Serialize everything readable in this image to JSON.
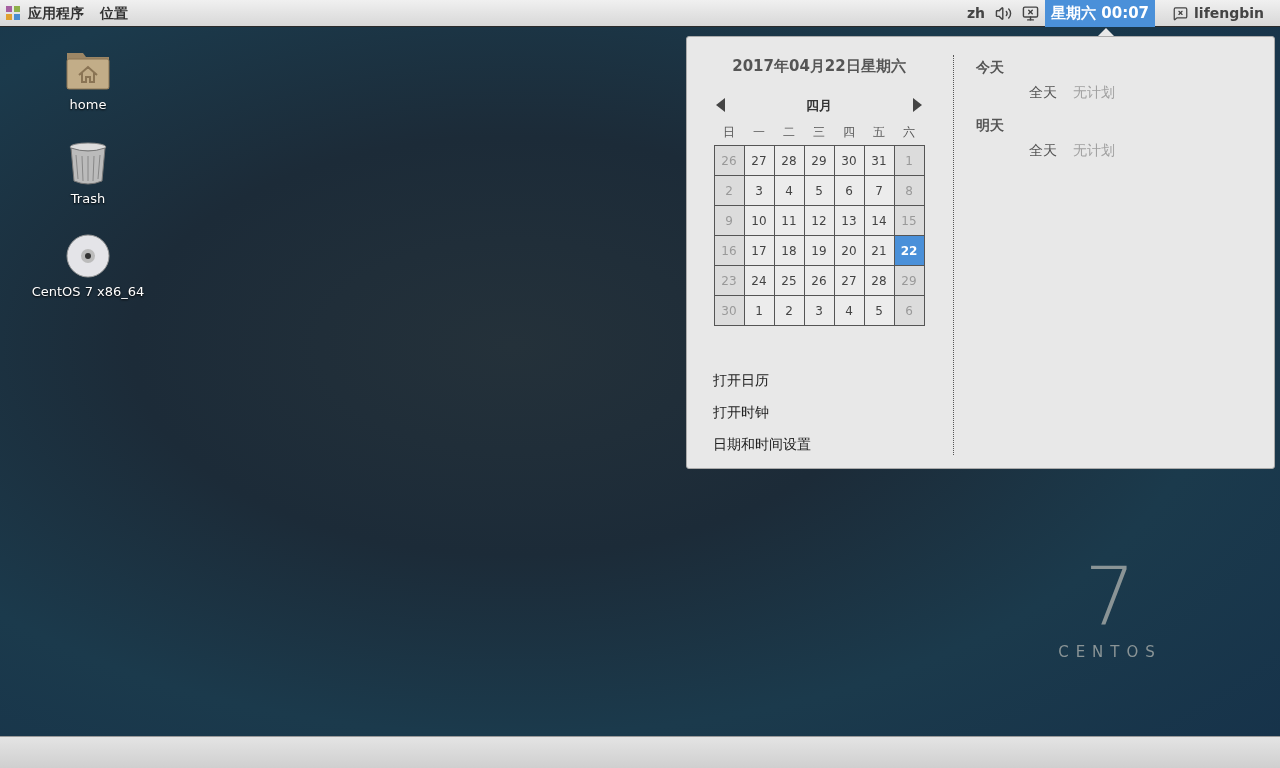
{
  "top_bar": {
    "menus": [
      {
        "label": "应用程序"
      },
      {
        "label": "位置"
      }
    ],
    "language": "zh",
    "clock": {
      "label": "星期六 00:07",
      "selected": true
    },
    "user": "lifengbin"
  },
  "desktop_icons": [
    {
      "kind": "home",
      "label": "home"
    },
    {
      "kind": "trash",
      "label": "Trash"
    },
    {
      "kind": "disc",
      "label": "CentOS 7 x86_64"
    }
  ],
  "calendar_popup": {
    "date_heading": "2017年04月22日星期六",
    "month": "四月",
    "weekdays": [
      "日",
      "一",
      "二",
      "三",
      "四",
      "五",
      "六"
    ],
    "weeks": [
      [
        {
          "day": "26",
          "selected": false
        },
        {
          "day": "27",
          "selected": false
        },
        {
          "day": "28",
          "selected": false
        },
        {
          "day": "29",
          "selected": false
        },
        {
          "day": "30",
          "selected": false
        },
        {
          "day": "31",
          "selected": false
        },
        {
          "day": "1",
          "selected": false
        }
      ],
      [
        {
          "day": "2",
          "selected": false
        },
        {
          "day": "3",
          "selected": false
        },
        {
          "day": "4",
          "selected": false
        },
        {
          "day": "5",
          "selected": false
        },
        {
          "day": "6",
          "selected": false
        },
        {
          "day": "7",
          "selected": false
        },
        {
          "day": "8",
          "selected": false
        }
      ],
      [
        {
          "day": "9",
          "selected": false
        },
        {
          "day": "10",
          "selected": false
        },
        {
          "day": "11",
          "selected": false
        },
        {
          "day": "12",
          "selected": false
        },
        {
          "day": "13",
          "selected": false
        },
        {
          "day": "14",
          "selected": false
        },
        {
          "day": "15",
          "selected": false
        }
      ],
      [
        {
          "day": "16",
          "selected": false
        },
        {
          "day": "17",
          "selected": false
        },
        {
          "day": "18",
          "selected": false
        },
        {
          "day": "19",
          "selected": false
        },
        {
          "day": "20",
          "selected": false
        },
        {
          "day": "21",
          "selected": false
        },
        {
          "day": "22",
          "selected": true
        }
      ],
      [
        {
          "day": "23",
          "selected": false
        },
        {
          "day": "24",
          "selected": false
        },
        {
          "day": "25",
          "selected": false
        },
        {
          "day": "26",
          "selected": false
        },
        {
          "day": "27",
          "selected": false
        },
        {
          "day": "28",
          "selected": false
        },
        {
          "day": "29",
          "selected": false
        }
      ],
      [
        {
          "day": "30",
          "selected": false
        },
        {
          "day": "1",
          "selected": false
        },
        {
          "day": "2",
          "selected": false
        },
        {
          "day": "3",
          "selected": false
        },
        {
          "day": "4",
          "selected": false
        },
        {
          "day": "5",
          "selected": false
        },
        {
          "day": "6",
          "selected": false
        }
      ]
    ],
    "actions": [
      "打开日历",
      "打开时钟",
      "日期和时间设置"
    ],
    "events": [
      {
        "day": "今天",
        "time": "全天",
        "text": "无计划"
      },
      {
        "day": "明天",
        "time": "全天",
        "text": "无计划"
      }
    ]
  },
  "wallpaper": {
    "version": "7",
    "brand": "CENTOS"
  }
}
